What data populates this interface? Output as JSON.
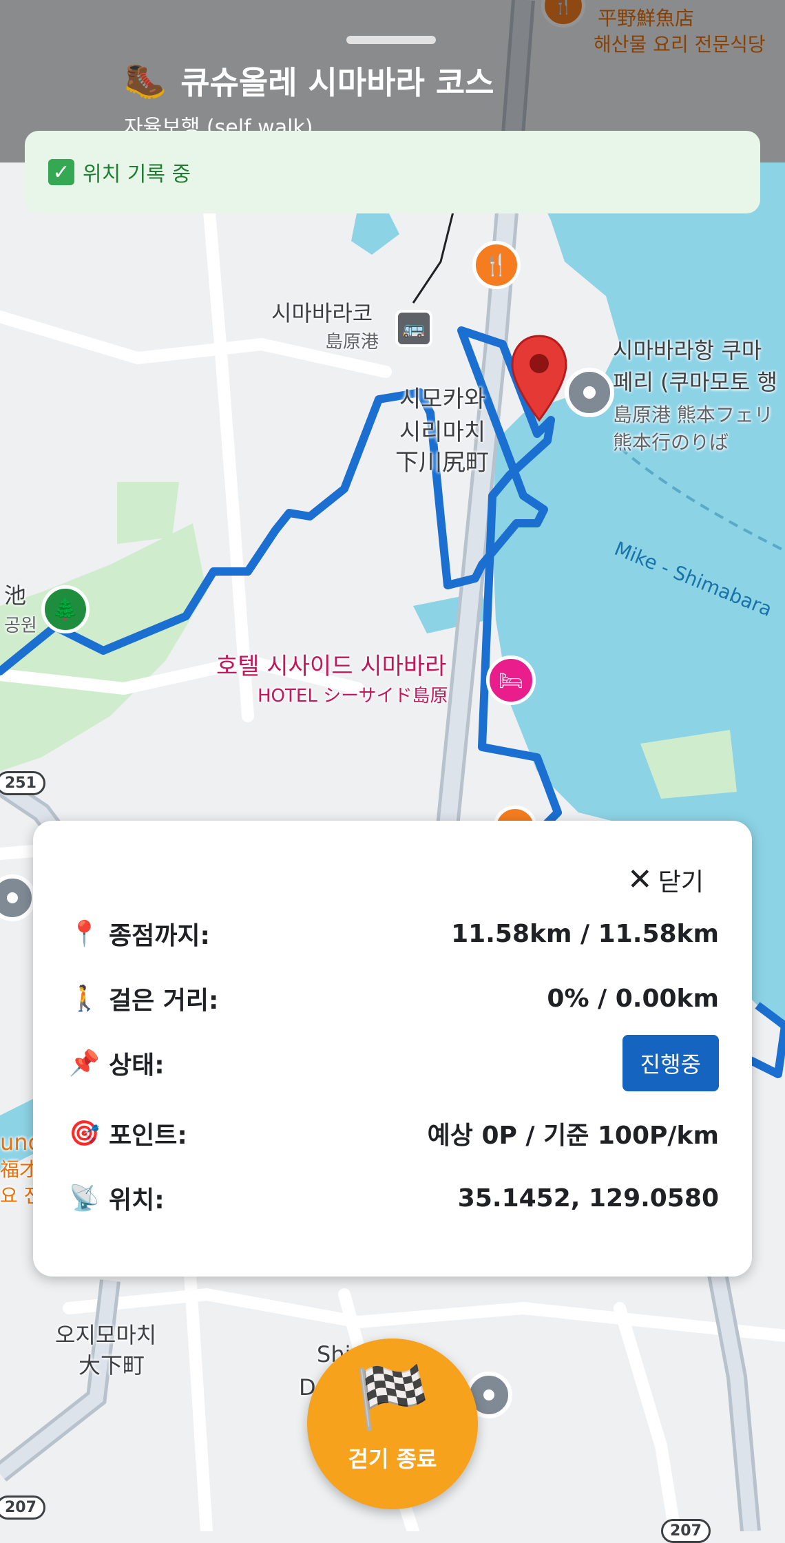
{
  "header": {
    "title": "큐슈올레 시마바라 코스",
    "subtitle": "자율보행 (self walk)",
    "boot_icon": "hiking-boot-icon"
  },
  "recording_banner": {
    "text": "위치 기록 중",
    "icon": "check-box-icon"
  },
  "map": {
    "labels": {
      "station": "시마바라코",
      "station_jp": "島原港",
      "area1": "시모카와",
      "area2": "시리마치",
      "area_jp": "下川尻町",
      "ferry1": "시마바라항 쿠마",
      "ferry2": "페리 (쿠마모토 행",
      "ferry_jp1": "島原港 熊本フェリ",
      "ferry_jp2": "熊本行のりば",
      "hotel": "호텔 시사이드 시마바라",
      "hotel_jp": "HOTEL シーサイド島原",
      "restaurant_jp": "平野鮮魚店",
      "restaurant_kr": "해산물 요리 전문식당",
      "park_jp": "池",
      "park_kr": "공원",
      "sea": "Mike - Shimabara",
      "town": "오지모마치",
      "town_jp": "大下町",
      "drive": "Shimabara",
      "drive2": "Driving",
      "left_partial1": "unc",
      "left_partial2": "福才",
      "left_partial3": "요 전",
      "route_251": "251",
      "route_207": "207",
      "route_207b": "207"
    }
  },
  "info": {
    "close_label": "닫기",
    "rows": [
      {
        "icon": "📍",
        "label": "종점까지:",
        "value": "11.58km / 11.58km"
      },
      {
        "icon": "🚶",
        "label": "걸은 거리:",
        "value": "0% / 0.00km"
      },
      {
        "icon": "📌",
        "label": "상태:",
        "value": "진행중"
      },
      {
        "icon": "🎯",
        "label": "포인트:",
        "value": "예상 0P / 기준 100P/km"
      },
      {
        "icon": "📡",
        "label": "위치:",
        "value": "35.1452, 129.0580"
      }
    ]
  },
  "end_button": {
    "label": "걷기 종료",
    "icon": "checkered-flag-icon"
  },
  "colors": {
    "route": "#1a6fd0",
    "water": "#8cd3e6",
    "park": "#cfeccc",
    "end_button": "#f6a21d",
    "status_badge": "#1565c0"
  }
}
